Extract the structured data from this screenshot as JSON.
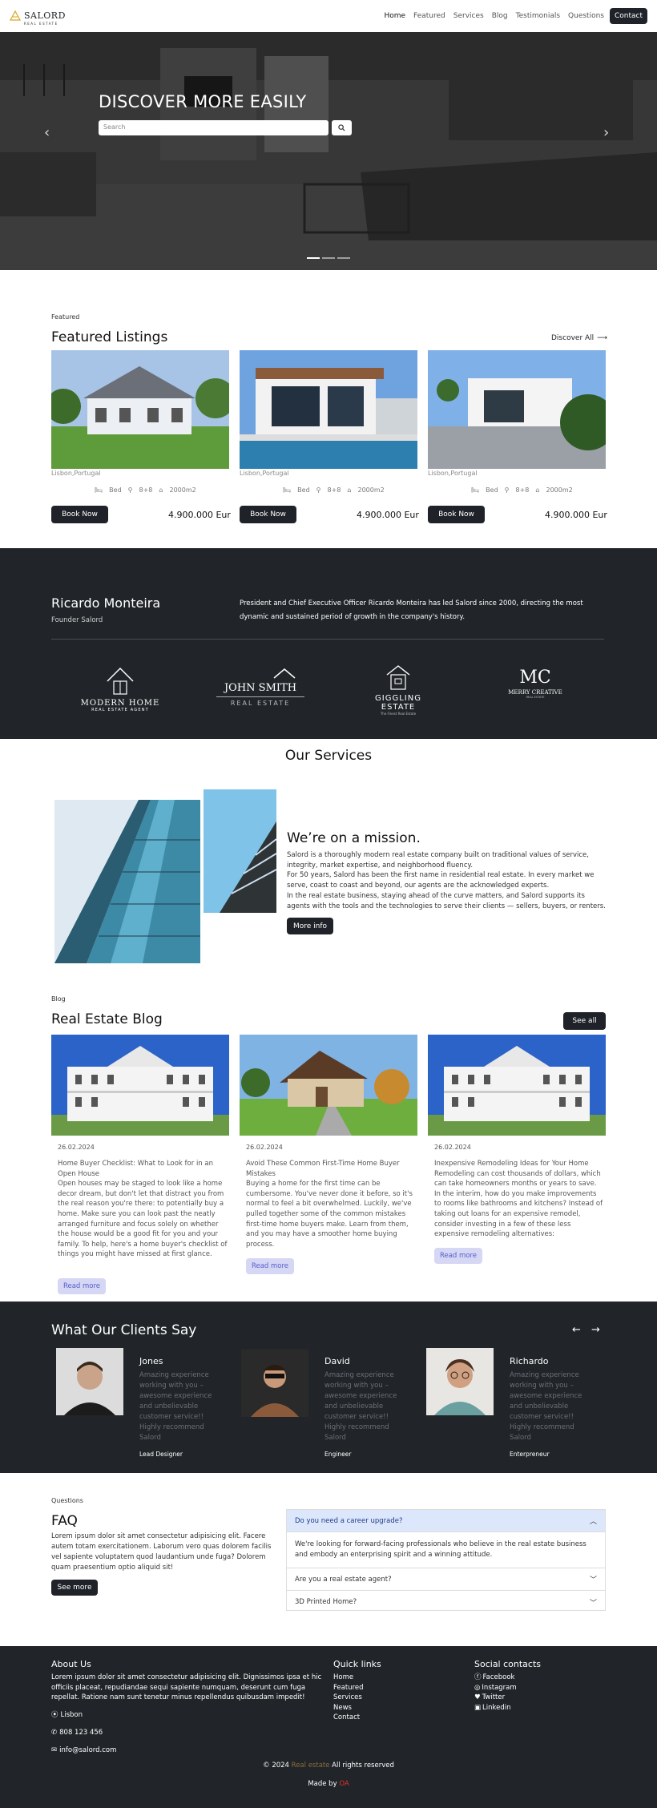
{
  "nav": {
    "logo_text": "SALORD",
    "logo_sub": "REAL ESTATE",
    "items": [
      "Home",
      "Featured",
      "Services",
      "Blog",
      "Testimonials",
      "Questions"
    ],
    "contact": "Contact"
  },
  "hero": {
    "title": "DISCOVER MORE EASILY",
    "search_placeholder": "Search"
  },
  "featured": {
    "eyebrow": "Featured",
    "title": "Featured Listings",
    "discover": "Discover All",
    "cards": [
      {
        "location": "Lisbon,Portugal",
        "bed": "Bed",
        "bath": "8+8",
        "area": "2000m2",
        "button": "Book Now",
        "price": "4.900.000 Eur"
      },
      {
        "location": "Lisbon,Portugal",
        "bed": "Bed",
        "bath": "8+8",
        "area": "2000m2",
        "button": "Book Now",
        "price": "4.900.000 Eur"
      },
      {
        "location": "Lisbon,Portugal",
        "bed": "Bed",
        "bath": "8+8",
        "area": "2000m2",
        "button": "Book Now",
        "price": "4.900.000 Eur"
      }
    ]
  },
  "founder": {
    "name": "Ricardo Monteira",
    "role": "Founder Salord",
    "bio": "President and Chief Executive Officer Ricardo Monteira has led Salord since 2000, directing the most dynamic and sustained period of growth in the company's history.",
    "brands": [
      {
        "line1": "MODERN",
        "line2": "HOME",
        "line3": "REAL ESTATE AGENT"
      },
      {
        "line1": "JOHN SMITH",
        "line2": "REAL ESTATE"
      },
      {
        "line1": "GIGGLING",
        "line2": "ESTATE",
        "line3": "The Finest Real Estate"
      },
      {
        "line1": "MC",
        "line2": "MERRY CREATIVE",
        "line3": "REAL ESTATE"
      }
    ]
  },
  "services": {
    "title": "Our Services",
    "mission_title": "We’re on a mission.",
    "p1": "Salord is a thoroughly modern real estate company built on traditional values of service, integrity, market expertise, and neighborhood fluency.",
    "p2": "For 50 years, Salord has been the first name in residential real estate. In every market we serve, coast to coast and beyond, our agents are the acknowledged experts.",
    "p3": "In the real estate business, staying ahead of the curve matters, and Salord supports its agents with the tools and the technologies to serve their clients — sellers, buyers, or renters.",
    "button": "More info"
  },
  "blog": {
    "eyebrow": "Blog",
    "title": "Real Estate Blog",
    "see_all": "See all",
    "posts": [
      {
        "date": "26.02.2024",
        "title": "Home Buyer Checklist: What to Look for in an Open House",
        "body": "Open houses may be staged to look like a home decor dream, but don't let that distract you from the real reason you're there: to potentially buy a home. Make sure you can look past the neatly arranged furniture and focus solely on whether the house would be a good fit for you and your family. To help, here's a home buyer's checklist of things you might have missed at first glance.",
        "button": "Read more"
      },
      {
        "date": "26.02.2024",
        "title": "Avoid These Common First-Time Home Buyer Mistakes",
        "body": "Buying a home for the first time can be cumbersome. You've never done it before, so it's normal to feel a bit overwhelmed. Luckily, we've pulled together some of the common mistakes first-time home buyers make. Learn from them, and you may have a smoother home buying process.",
        "button": "Read more"
      },
      {
        "date": "26.02.2024",
        "title": "Inexpensive Remodeling Ideas for Your Home",
        "body": "Remodeling can cost thousands of dollars, which can take homeowners months or years to save. In the interim, how do you make improvements to rooms like bathrooms and kitchens? Instead of taking out loans for an expensive remodel, consider investing in a few of these less expensive remodeling alternatives:",
        "button": "Read more"
      }
    ]
  },
  "testimonials": {
    "title": "What Our Clients Say",
    "prev": "←",
    "next": "→",
    "items": [
      {
        "name": "Jones",
        "text": "Amazing experience working with you – awesome experience and unbelievable customer service!! Highly recommend Salord",
        "role": "Lead Designer"
      },
      {
        "name": "David",
        "text": "Amazing experience working with you – awesome experience and unbelievable customer service!! Highly recommend Salord",
        "role": "Engineer"
      },
      {
        "name": "Richardo",
        "text": "Amazing experience working with you – awesome experience and unbelievable customer service!! Highly recommend Salord",
        "role": "Enterpreneur"
      }
    ]
  },
  "faq": {
    "eyebrow": "Questions",
    "title": "FAQ",
    "body": "Lorem ipsum dolor sit amet consectetur adipisicing elit. Facere autem totam exercitationem. Laborum vero quas dolorem facilis vel sapiente voluptatem quod laudantium unde fuga? Dolorem quam praesentium optio aliquid sit!",
    "button": "See more",
    "items": [
      {
        "q": "Do you need a career upgrade?",
        "a": "We're looking for forward-facing professionals who believe in the real estate business and embody an enterprising spirit and a winning attitude."
      },
      {
        "q": "Are you a real estate agent?"
      },
      {
        "q": "3D Printed Home?"
      }
    ]
  },
  "footer": {
    "about_title": "About Us",
    "about_text": "Lorem ipsum dolor sit amet consectetur adipisicing elit. Dignissimos ipsa et hic officiis placeat, repudiandae sequi sapiente numquam, deserunt cum fuga repellat. Ratione nam sunt tenetur minus repellendus quibusdam impedit!",
    "location": "Lisbon",
    "phone": "808 123 456",
    "email": "info@salord.com",
    "links_title": "Quick links",
    "links": [
      "Home",
      "Featured",
      "Services",
      "News",
      "Contact"
    ],
    "social_title": "Social contacts",
    "social": [
      "Facebook",
      "Instagram",
      "Twitter",
      "Linkedin"
    ],
    "copy_prefix": "© 2024",
    "copy_link": "Real estate",
    "copy_suffix": "All rights reserved",
    "made_prefix": "Made by",
    "made_link": "OA",
    "link_color": "#8a6d3b",
    "made_color": "#e0302a"
  }
}
